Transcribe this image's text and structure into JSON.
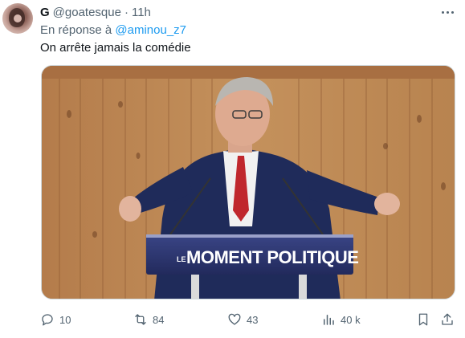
{
  "author": {
    "name": "G",
    "handle": "@goatesque",
    "separator": "·",
    "time": "11h"
  },
  "reply_context": {
    "prefix": "En réponse à",
    "mention": "@aminou_z7"
  },
  "tweet_text": "On arrête jamais la comédie",
  "media": {
    "podium_text": "MOMENT POLITIQUE",
    "podium_prefix": "LE",
    "podium_color": "#27306a"
  },
  "actions": {
    "replies": "10",
    "reposts": "84",
    "likes": "43",
    "views": "40 k"
  },
  "icons": [
    "more-icon",
    "reply-icon",
    "repost-icon",
    "like-icon",
    "views-icon",
    "bookmark-icon",
    "share-icon"
  ],
  "colors": {
    "text_primary": "#0f1419",
    "text_secondary": "#536471",
    "link": "#1d9bf0"
  }
}
